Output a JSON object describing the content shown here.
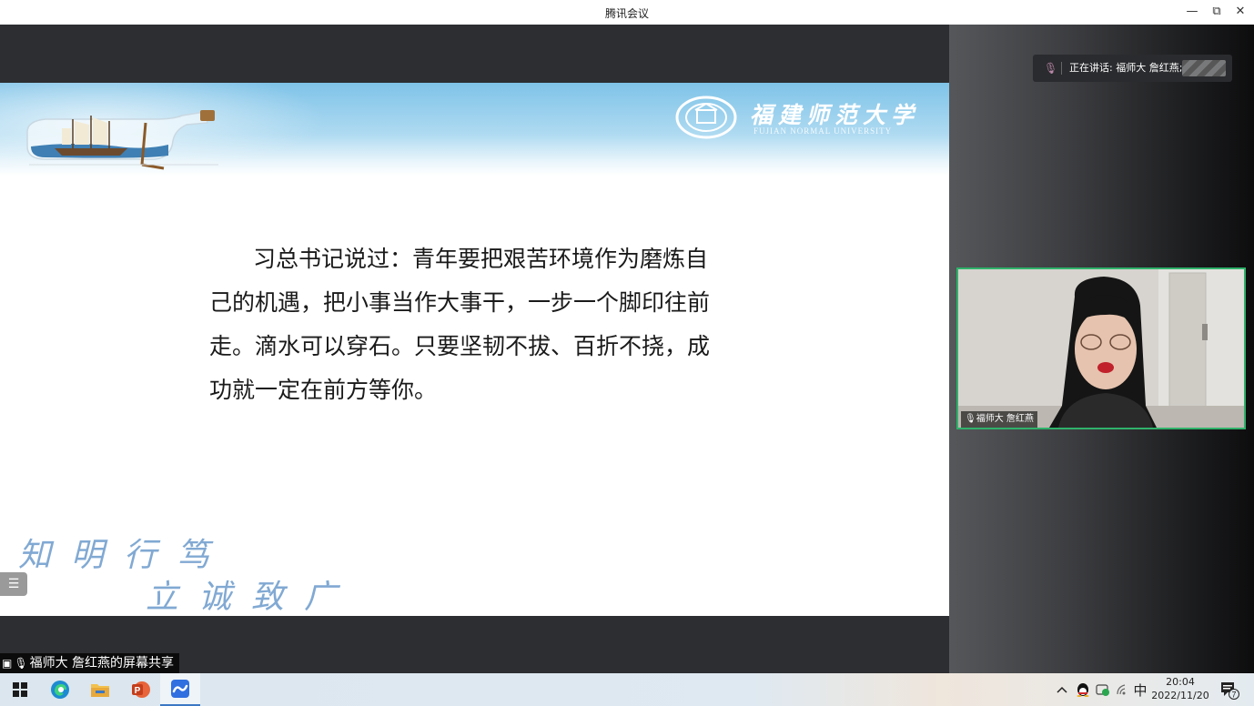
{
  "window": {
    "title": "腾讯会议",
    "minimize_icon": "—",
    "restore_icon": "⧉",
    "close_icon": "✕"
  },
  "slide": {
    "university_name": "福建师范大学",
    "university_name_en": "FUJIAN NORMAL UNIVERSITY",
    "body_text": "习总书记说过：青年要把艰苦环境作为磨炼自己的机遇，把小事当作大事干，一步一个脚印往前走。滴水可以穿石。只要坚韧不拔、百折不挠，成功就一定在前方等你。",
    "motto_line1": "知明行笃",
    "motto_line2": "立诚致广"
  },
  "share": {
    "label": "福师大 詹红燕的屏幕共享",
    "side_menu_icon": "☰"
  },
  "speaking": {
    "text": "正在讲话: 福师大 詹红燕;"
  },
  "video": {
    "participant_label": "福师大 詹红燕"
  },
  "taskbar": {
    "apps": [
      "windows-start",
      "edge",
      "file-explorer",
      "powerpoint",
      "tencent-meeting"
    ],
    "tray_chevron": "^",
    "ime": "中",
    "time": "20:04",
    "date": "2022/11/20",
    "notification_count": "7"
  },
  "colors": {
    "speaker_border": "#2fb26b",
    "banner_blue": "#7fc3e8",
    "motto_blue": "#6c9bcc"
  }
}
